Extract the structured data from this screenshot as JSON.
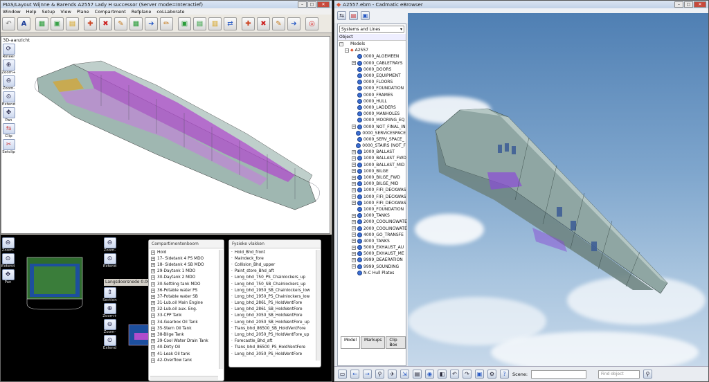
{
  "left": {
    "title": "PIAS/Layout Wijnne & Barends A2557 Lady H successor (Server mode=Interactief)",
    "menu": [
      "Window",
      "Help",
      "Setup",
      "View",
      "Plane",
      "Compartment",
      "Refplane",
      "coLLaborate"
    ],
    "view_label": "3D-aanzicht",
    "view_tools": [
      {
        "label": "Roteer",
        "icon": "rotate-icon"
      },
      {
        "label": "Zoom+",
        "icon": "zoom-in-icon"
      },
      {
        "label": "Zoom-",
        "icon": "zoom-out-icon"
      },
      {
        "label": "Extend",
        "icon": "extend-icon"
      },
      {
        "label": "Pan",
        "icon": "pan-icon"
      },
      {
        "label": "Clip",
        "icon": "clip-icon"
      },
      {
        "label": "Setclip",
        "icon": "setclip-icon"
      }
    ],
    "bottom_left_tools": [
      {
        "label": "Zoom-",
        "icon": "zoom-out-icon"
      },
      {
        "label": "Extend",
        "icon": "extend-icon"
      },
      {
        "label": "Pan",
        "icon": "pan-icon"
      }
    ],
    "mid_tools": [
      {
        "label": "Zoom-",
        "icon": "zoom-out-icon"
      },
      {
        "label": "Extend",
        "icon": "extend-icon"
      }
    ],
    "langs_label": "Langsdoorsnede 0.000",
    "langs_tools": [
      {
        "label": "Section",
        "icon": "section-icon"
      },
      {
        "label": "Zoom+",
        "icon": "zoom-in-icon"
      },
      {
        "label": "Zoom-",
        "icon": "zoom-out-icon"
      },
      {
        "label": "Extend",
        "icon": "extend-icon"
      }
    ],
    "compartments": {
      "title": "Compartimentenboom",
      "items": [
        "Hold",
        "17- Sidetank 4 PS MDO",
        "18- Sidetank 4 SB MDO",
        "29-Daytank 1 MDO",
        "30-Daytank 2 MDO",
        "30-Settling tank MDO",
        "36-Potable water PS",
        "37-Potable water SB",
        "31-Lub.oil Main Engine",
        "32-Lub.oil aux. Eng.",
        "33-CPP Tank",
        "34-Gearbox Oil Tank",
        "35-Stern Oil Tank",
        "38-Bilge Tank",
        "39-Cool Water Drain Tank",
        "40-Dirty Oil",
        "41-Leak Oil tank",
        "42-Overflow tank"
      ]
    },
    "planes": {
      "title": "Fysieke vlakken",
      "items": [
        "Hold_Bhd_front",
        "Maindeck_fore",
        "Collision_Bhd_upper",
        "Paint_store_Bhd_aft",
        "Long_bhd_750_PS_Chainlockers_up",
        "Long_bhd_750_SB_Chainlockers_up",
        "Long_bhd_1950_SB_Chainlockers_low",
        "Long_bhd_1950_PS_Chainlockers_low",
        "Long_bhd_2861_PS_HoldVentFore",
        "Long_bhd_2861_SB_HoldVentFore",
        "Long_bhd_3050_SB_HoldVentFore",
        "Long_bhd_2050_SB_HoldVentFore_up",
        "Trans_bhd_86500_SB_HoldVentFore",
        "Long_bhd_2050_PS_HoldVentFore_up",
        "Forecastle_Bhd_aft",
        "Trans_bhd_86500_PS_HoldVentFore",
        "Long_bhd_3050_PS_HoldVentFore"
      ]
    }
  },
  "right": {
    "title": "A2557.ebm - Cadmatic eBrowser",
    "dropdown": "Systems and Lines",
    "object_header": "Object",
    "root": "Models",
    "model": "A2557",
    "tree_items": [
      {
        "label": "0000_ALGEMEEN",
        "exp": false
      },
      {
        "label": "0000_CABLETRAYS",
        "exp": true
      },
      {
        "label": "0000_DOORS",
        "exp": false
      },
      {
        "label": "0000_EQUIPMENT",
        "exp": false
      },
      {
        "label": "0000_FLOORS",
        "exp": false
      },
      {
        "label": "0000_FOUNDATION",
        "exp": false
      },
      {
        "label": "0000_FRAMES",
        "exp": false
      },
      {
        "label": "0000_HULL",
        "exp": false
      },
      {
        "label": "0000_LADDERS",
        "exp": false
      },
      {
        "label": "0000_MANHOLES",
        "exp": false
      },
      {
        "label": "0000_MOORING_EQ",
        "exp": false
      },
      {
        "label": "0000_NOT_FINAL_IN",
        "exp": true
      },
      {
        "label": "0000_SERVICESPACE",
        "exp": false
      },
      {
        "label": "0000_SERV_SPACE_",
        "exp": false
      },
      {
        "label": "0000_STAIRS (NOT_F",
        "exp": false
      },
      {
        "label": "1000_BALLAST",
        "exp": true
      },
      {
        "label": "1000_BALLAST_FWD",
        "exp": true
      },
      {
        "label": "1000_BALLAST_MID",
        "exp": true
      },
      {
        "label": "1000_BILGE",
        "exp": true
      },
      {
        "label": "1000_BILGE_FWD",
        "exp": true
      },
      {
        "label": "1000_BILGE_MID",
        "exp": true
      },
      {
        "label": "1000_FIFI_DECKWAS",
        "exp": true
      },
      {
        "label": "1000_FIFI_DECKWAS",
        "exp": true
      },
      {
        "label": "1000_FIFI_DECKWAS",
        "exp": true
      },
      {
        "label": "1000_FOUNDATION",
        "exp": false
      },
      {
        "label": "1000_TANKS",
        "exp": true
      },
      {
        "label": "2000_COOLINGWATE",
        "exp": true
      },
      {
        "label": "2000_COOLINGWATE",
        "exp": true
      },
      {
        "label": "4000_GO_TRANSFE",
        "exp": true
      },
      {
        "label": "4000_TANKS",
        "exp": true
      },
      {
        "label": "5000_EXHAUST_AU",
        "exp": true
      },
      {
        "label": "5000_EXHAUST_ME",
        "exp": true
      },
      {
        "label": "9999_DEAERATION",
        "exp": true
      },
      {
        "label": "9999_SOUNDING",
        "exp": true
      },
      {
        "label": "N-C Hull Plates",
        "exp": false
      }
    ],
    "tabs": [
      "Model",
      "Markups",
      "Clip Box"
    ],
    "scene_label": "Scene:",
    "find_placeholder": "Find object"
  },
  "colors": {
    "hull_purple": "#b04dcc",
    "hull_grey": "#8fa6a3",
    "sky_top": "#4f7fb3"
  }
}
